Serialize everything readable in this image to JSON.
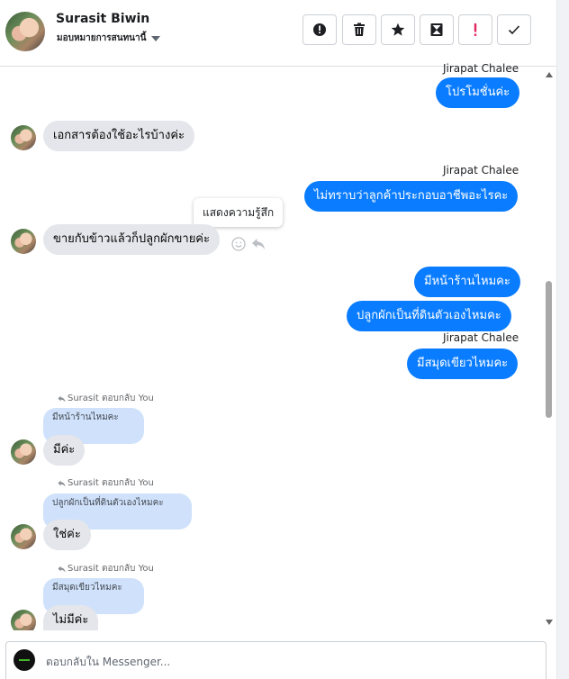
{
  "header": {
    "contact_name": "Surasit Biwin",
    "contact_subtitle": "มอบหมายการสนทนานี้",
    "toolbar": [
      {
        "name": "report-button",
        "icon": "alert-circle-icon"
      },
      {
        "name": "delete-button",
        "icon": "trash-icon"
      },
      {
        "name": "star-button",
        "icon": "star-icon"
      },
      {
        "name": "archive-button",
        "icon": "archive-icon"
      },
      {
        "name": "important-button",
        "icon": "exclamation-icon",
        "color": "#e0245e"
      },
      {
        "name": "done-button",
        "icon": "check-icon"
      }
    ]
  },
  "colors": {
    "outgoing_bubble": "#0a7cff",
    "incoming_bubble": "#e4e6eb",
    "quoted_bubble": "#cfe1fb"
  },
  "messages": {
    "m1": {
      "sender": "Jirapat Chalee",
      "text": "โปรโมชั่นค่ะ"
    },
    "m2": {
      "text": "เอกสารต้องใช้อะไรบ้างค่ะ"
    },
    "m3": {
      "sender": "Jirapat Chalee",
      "text": "ไม่ทราบว่าลูกค้าประกอบอาชีพอะไรคะ"
    },
    "m4": {
      "text": "ขายกับข้าวแล้วก็ปลูกผักขายค่ะ"
    },
    "m5": {
      "text": "มีหน้าร้านไหมคะ"
    },
    "m6": {
      "text": "ปลูกผักเป็นที่ดินตัวเองไหมคะ"
    },
    "m7": {
      "sender": "Jirapat Chalee",
      "text": "มีสมุดเขียวไหมคะ"
    },
    "r1": {
      "meta": "Surasit ตอบกลับ You",
      "quote": "มีหน้าร้านไหมคะ",
      "text": "มีค่ะ"
    },
    "r2": {
      "meta": "Surasit ตอบกลับ You",
      "quote": "ปลูกผักเป็นที่ดินตัวเองไหมคะ",
      "text": "ใช่ค่ะ"
    },
    "r3": {
      "meta": "Surasit ตอบกลับ You",
      "quote": "มีสมุดเขียวไหมคะ",
      "text": "ไม่มีค่ะ"
    }
  },
  "tooltip": {
    "text": "แสดงความรู้สึก"
  },
  "composer": {
    "placeholder": "ตอบกลับใน Messenger..."
  }
}
